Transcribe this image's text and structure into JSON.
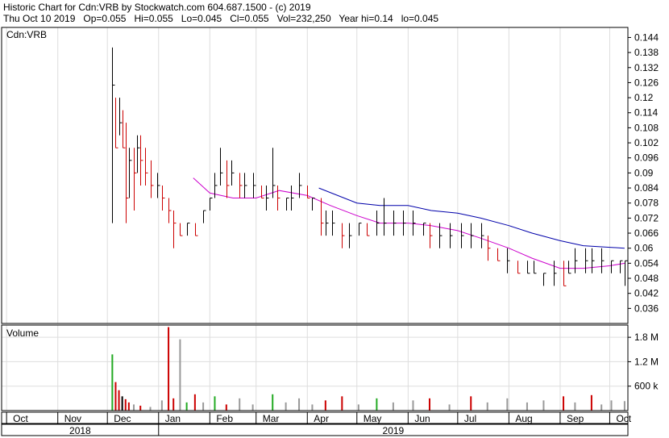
{
  "header": {
    "line1": "Historic Chart for Cdn:VRB by Stockwatch.com 604.687.1500 - (c) 2019",
    "line2": "Thu Oct 10 2019   Op=0.055   Hi=0.055   Lo=0.045   Cl=0.055   Vol=232,250   Year hi=0.14   lo=0.045"
  },
  "chart_data": {
    "type": "line",
    "price_panel": {
      "label": "Cdn:VRB",
      "ylim": [
        0.03,
        0.148
      ],
      "yticks": [
        "0.144",
        "0.138",
        "0.132",
        "0.126",
        "0.12",
        "0.114",
        "0.108",
        "0.102",
        "0.096",
        "0.09",
        "0.084",
        "0.078",
        "0.072",
        "0.066",
        "0.06",
        "0.054",
        "0.048",
        "0.042",
        "0.036"
      ],
      "ytick_values": [
        0.144,
        0.138,
        0.132,
        0.126,
        0.12,
        0.114,
        0.108,
        0.102,
        0.096,
        0.09,
        0.084,
        0.078,
        0.072,
        0.066,
        0.06,
        0.054,
        0.048,
        0.042,
        0.036
      ],
      "bar_colors": {
        "up": "#000000",
        "down": "#cc0000"
      },
      "bars": [
        {
          "d": "2018-12-04",
          "h": 0.14,
          "l": 0.07,
          "c": 0.125
        },
        {
          "d": "2018-12-06",
          "h": 0.12,
          "l": 0.1,
          "c": 0.1
        },
        {
          "d": "2018-12-08",
          "h": 0.12,
          "l": 0.105,
          "c": 0.11
        },
        {
          "d": "2018-12-10",
          "h": 0.115,
          "l": 0.1,
          "c": 0.1
        },
        {
          "d": "2018-12-12",
          "h": 0.11,
          "l": 0.07,
          "c": 0.08
        },
        {
          "d": "2018-12-14",
          "h": 0.1,
          "l": 0.08,
          "c": 0.095
        },
        {
          "d": "2018-12-17",
          "h": 0.1,
          "l": 0.075,
          "c": 0.09
        },
        {
          "d": "2018-12-19",
          "h": 0.105,
          "l": 0.09,
          "c": 0.1
        },
        {
          "d": "2018-12-21",
          "h": 0.105,
          "l": 0.085,
          "c": 0.095
        },
        {
          "d": "2018-12-24",
          "h": 0.1,
          "l": 0.085,
          "c": 0.09
        },
        {
          "d": "2018-12-27",
          "h": 0.095,
          "l": 0.08,
          "c": 0.085
        },
        {
          "d": "2018-12-31",
          "h": 0.09,
          "l": 0.08,
          "c": 0.085
        },
        {
          "d": "2019-01-03",
          "h": 0.085,
          "l": 0.075,
          "c": 0.08
        },
        {
          "d": "2019-01-07",
          "h": 0.08,
          "l": 0.07,
          "c": 0.075
        },
        {
          "d": "2019-01-10",
          "h": 0.075,
          "l": 0.06,
          "c": 0.07
        },
        {
          "d": "2019-01-14",
          "h": 0.07,
          "l": 0.065,
          "c": 0.065
        },
        {
          "d": "2019-01-18",
          "h": 0.07,
          "l": 0.065,
          "c": 0.07
        },
        {
          "d": "2019-01-23",
          "h": 0.07,
          "l": 0.065,
          "c": 0.065
        },
        {
          "d": "2019-01-28",
          "h": 0.075,
          "l": 0.07,
          "c": 0.075
        },
        {
          "d": "2019-02-01",
          "h": 0.08,
          "l": 0.075,
          "c": 0.08
        },
        {
          "d": "2019-02-04",
          "h": 0.09,
          "l": 0.08,
          "c": 0.085
        },
        {
          "d": "2019-02-07",
          "h": 0.1,
          "l": 0.085,
          "c": 0.09
        },
        {
          "d": "2019-02-11",
          "h": 0.095,
          "l": 0.08,
          "c": 0.085
        },
        {
          "d": "2019-02-14",
          "h": 0.095,
          "l": 0.085,
          "c": 0.09
        },
        {
          "d": "2019-02-19",
          "h": 0.09,
          "l": 0.08,
          "c": 0.085
        },
        {
          "d": "2019-02-22",
          "h": 0.09,
          "l": 0.08,
          "c": 0.085
        },
        {
          "d": "2019-02-27",
          "h": 0.09,
          "l": 0.08,
          "c": 0.085
        },
        {
          "d": "2019-03-04",
          "h": 0.085,
          "l": 0.08,
          "c": 0.08
        },
        {
          "d": "2019-03-07",
          "h": 0.085,
          "l": 0.075,
          "c": 0.08
        },
        {
          "d": "2019-03-11",
          "h": 0.1,
          "l": 0.08,
          "c": 0.085
        },
        {
          "d": "2019-03-14",
          "h": 0.085,
          "l": 0.075,
          "c": 0.08
        },
        {
          "d": "2019-03-19",
          "h": 0.08,
          "l": 0.075,
          "c": 0.08
        },
        {
          "d": "2019-03-22",
          "h": 0.085,
          "l": 0.075,
          "c": 0.08
        },
        {
          "d": "2019-03-27",
          "h": 0.09,
          "l": 0.08,
          "c": 0.085
        },
        {
          "d": "2019-04-01",
          "h": 0.085,
          "l": 0.08,
          "c": 0.08
        },
        {
          "d": "2019-04-04",
          "h": 0.08,
          "l": 0.075,
          "c": 0.08
        },
        {
          "d": "2019-04-09",
          "h": 0.08,
          "l": 0.065,
          "c": 0.07
        },
        {
          "d": "2019-04-12",
          "h": 0.075,
          "l": 0.065,
          "c": 0.07
        },
        {
          "d": "2019-04-16",
          "h": 0.075,
          "l": 0.065,
          "c": 0.07
        },
        {
          "d": "2019-04-22",
          "h": 0.07,
          "l": 0.06,
          "c": 0.065
        },
        {
          "d": "2019-04-26",
          "h": 0.07,
          "l": 0.06,
          "c": 0.065
        },
        {
          "d": "2019-05-02",
          "h": 0.07,
          "l": 0.065,
          "c": 0.07
        },
        {
          "d": "2019-05-07",
          "h": 0.07,
          "l": 0.065,
          "c": 0.065
        },
        {
          "d": "2019-05-13",
          "h": 0.075,
          "l": 0.065,
          "c": 0.07
        },
        {
          "d": "2019-05-17",
          "h": 0.08,
          "l": 0.065,
          "c": 0.07
        },
        {
          "d": "2019-05-23",
          "h": 0.075,
          "l": 0.065,
          "c": 0.07
        },
        {
          "d": "2019-05-29",
          "h": 0.075,
          "l": 0.065,
          "c": 0.07
        },
        {
          "d": "2019-06-04",
          "h": 0.075,
          "l": 0.065,
          "c": 0.07
        },
        {
          "d": "2019-06-10",
          "h": 0.07,
          "l": 0.065,
          "c": 0.07
        },
        {
          "d": "2019-06-14",
          "h": 0.07,
          "l": 0.06,
          "c": 0.065
        },
        {
          "d": "2019-06-20",
          "h": 0.07,
          "l": 0.06,
          "c": 0.065
        },
        {
          "d": "2019-06-26",
          "h": 0.07,
          "l": 0.06,
          "c": 0.065
        },
        {
          "d": "2019-07-03",
          "h": 0.07,
          "l": 0.06,
          "c": 0.065
        },
        {
          "d": "2019-07-09",
          "h": 0.07,
          "l": 0.06,
          "c": 0.065
        },
        {
          "d": "2019-07-15",
          "h": 0.07,
          "l": 0.06,
          "c": 0.065
        },
        {
          "d": "2019-07-19",
          "h": 0.065,
          "l": 0.055,
          "c": 0.06
        },
        {
          "d": "2019-07-25",
          "h": 0.06,
          "l": 0.055,
          "c": 0.055
        },
        {
          "d": "2019-07-31",
          "h": 0.06,
          "l": 0.05,
          "c": 0.055
        },
        {
          "d": "2019-08-06",
          "h": 0.055,
          "l": 0.05,
          "c": 0.05
        },
        {
          "d": "2019-08-12",
          "h": 0.055,
          "l": 0.05,
          "c": 0.05
        },
        {
          "d": "2019-08-16",
          "h": 0.055,
          "l": 0.05,
          "c": 0.05
        },
        {
          "d": "2019-08-22",
          "h": 0.05,
          "l": 0.045,
          "c": 0.05
        },
        {
          "d": "2019-08-28",
          "h": 0.055,
          "l": 0.045,
          "c": 0.05
        },
        {
          "d": "2019-09-03",
          "h": 0.055,
          "l": 0.045,
          "c": 0.045
        },
        {
          "d": "2019-09-06",
          "h": 0.055,
          "l": 0.05,
          "c": 0.05
        },
        {
          "d": "2019-09-10",
          "h": 0.06,
          "l": 0.05,
          "c": 0.055
        },
        {
          "d": "2019-09-16",
          "h": 0.06,
          "l": 0.05,
          "c": 0.055
        },
        {
          "d": "2019-09-20",
          "h": 0.06,
          "l": 0.05,
          "c": 0.055
        },
        {
          "d": "2019-09-26",
          "h": 0.06,
          "l": 0.05,
          "c": 0.055
        },
        {
          "d": "2019-10-02",
          "h": 0.055,
          "l": 0.05,
          "c": 0.055
        },
        {
          "d": "2019-10-07",
          "h": 0.055,
          "l": 0.05,
          "c": 0.055
        },
        {
          "d": "2019-10-10",
          "h": 0.055,
          "l": 0.045,
          "c": 0.055
        }
      ],
      "moving_averages": [
        {
          "color": "#cc00cc",
          "points": [
            [
              "2019-01-22",
              0.088
            ],
            [
              "2019-02-01",
              0.082
            ],
            [
              "2019-02-15",
              0.08
            ],
            [
              "2019-03-01",
              0.08
            ],
            [
              "2019-03-15",
              0.083
            ],
            [
              "2019-04-01",
              0.081
            ],
            [
              "2019-04-15",
              0.077
            ],
            [
              "2019-05-01",
              0.073
            ],
            [
              "2019-05-15",
              0.07
            ],
            [
              "2019-06-01",
              0.07
            ],
            [
              "2019-06-15",
              0.069
            ],
            [
              "2019-07-01",
              0.067
            ],
            [
              "2019-07-15",
              0.064
            ],
            [
              "2019-08-01",
              0.06
            ],
            [
              "2019-08-15",
              0.056
            ],
            [
              "2019-09-01",
              0.052
            ],
            [
              "2019-09-15",
              0.052
            ],
            [
              "2019-10-01",
              0.053
            ],
            [
              "2019-10-10",
              0.054
            ]
          ]
        },
        {
          "color": "#0000aa",
          "points": [
            [
              "2019-04-08",
              0.084
            ],
            [
              "2019-05-01",
              0.078
            ],
            [
              "2019-05-15",
              0.077
            ],
            [
              "2019-06-01",
              0.077
            ],
            [
              "2019-06-15",
              0.075
            ],
            [
              "2019-07-01",
              0.074
            ],
            [
              "2019-07-15",
              0.072
            ],
            [
              "2019-08-01",
              0.069
            ],
            [
              "2019-08-15",
              0.066
            ],
            [
              "2019-09-01",
              0.063
            ],
            [
              "2019-09-15",
              0.061
            ],
            [
              "2019-10-10",
              0.06
            ]
          ]
        }
      ]
    },
    "volume_panel": {
      "label": "Volume",
      "ylim": [
        0,
        2100000
      ],
      "yticks": [
        "1.8 M",
        "1.2 M",
        "600 k"
      ],
      "ytick_values": [
        1800000,
        1200000,
        600000
      ],
      "bars": [
        {
          "d": "2018-12-04",
          "v": 1380000,
          "c": "#22aa22"
        },
        {
          "d": "2018-12-06",
          "v": 700000,
          "c": "#cc0000"
        },
        {
          "d": "2018-12-08",
          "v": 500000,
          "c": "#cc0000"
        },
        {
          "d": "2018-12-10",
          "v": 350000,
          "c": "#000000"
        },
        {
          "d": "2018-12-12",
          "v": 280000,
          "c": "#cc0000"
        },
        {
          "d": "2018-12-14",
          "v": 200000,
          "c": "#cc0000"
        },
        {
          "d": "2018-12-17",
          "v": 150000,
          "c": "#999999"
        },
        {
          "d": "2018-12-21",
          "v": 120000,
          "c": "#cc0000"
        },
        {
          "d": "2018-12-27",
          "v": 90000,
          "c": "#999999"
        },
        {
          "d": "2019-01-03",
          "v": 250000,
          "c": "#999999"
        },
        {
          "d": "2019-01-07",
          "v": 2050000,
          "c": "#cc0000"
        },
        {
          "d": "2019-01-10",
          "v": 300000,
          "c": "#cc0000"
        },
        {
          "d": "2019-01-14",
          "v": 1750000,
          "c": "#999999"
        },
        {
          "d": "2019-01-18",
          "v": 200000,
          "c": "#22aa22"
        },
        {
          "d": "2019-01-23",
          "v": 400000,
          "c": "#cc0000"
        },
        {
          "d": "2019-01-28",
          "v": 200000,
          "c": "#999999"
        },
        {
          "d": "2019-02-04",
          "v": 350000,
          "c": "#22aa22"
        },
        {
          "d": "2019-02-11",
          "v": 150000,
          "c": "#cc0000"
        },
        {
          "d": "2019-02-19",
          "v": 300000,
          "c": "#999999"
        },
        {
          "d": "2019-02-27",
          "v": 150000,
          "c": "#999999"
        },
        {
          "d": "2019-03-11",
          "v": 400000,
          "c": "#22aa22"
        },
        {
          "d": "2019-03-19",
          "v": 200000,
          "c": "#999999"
        },
        {
          "d": "2019-03-27",
          "v": 300000,
          "c": "#999999"
        },
        {
          "d": "2019-04-04",
          "v": 150000,
          "c": "#999999"
        },
        {
          "d": "2019-04-12",
          "v": 250000,
          "c": "#cc0000"
        },
        {
          "d": "2019-04-22",
          "v": 350000,
          "c": "#cc0000"
        },
        {
          "d": "2019-05-02",
          "v": 150000,
          "c": "#999999"
        },
        {
          "d": "2019-05-13",
          "v": 300000,
          "c": "#22aa22"
        },
        {
          "d": "2019-05-23",
          "v": 200000,
          "c": "#999999"
        },
        {
          "d": "2019-06-04",
          "v": 250000,
          "c": "#999999"
        },
        {
          "d": "2019-06-14",
          "v": 300000,
          "c": "#cc0000"
        },
        {
          "d": "2019-06-26",
          "v": 150000,
          "c": "#999999"
        },
        {
          "d": "2019-07-09",
          "v": 350000,
          "c": "#cc0000"
        },
        {
          "d": "2019-07-19",
          "v": 200000,
          "c": "#999999"
        },
        {
          "d": "2019-07-31",
          "v": 300000,
          "c": "#999999"
        },
        {
          "d": "2019-08-12",
          "v": 200000,
          "c": "#999999"
        },
        {
          "d": "2019-08-22",
          "v": 250000,
          "c": "#999999"
        },
        {
          "d": "2019-09-03",
          "v": 350000,
          "c": "#cc0000"
        },
        {
          "d": "2019-09-10",
          "v": 200000,
          "c": "#999999"
        },
        {
          "d": "2019-09-20",
          "v": 380000,
          "c": "#cc0000"
        },
        {
          "d": "2019-09-26",
          "v": 150000,
          "c": "#999999"
        },
        {
          "d": "2019-10-02",
          "v": 250000,
          "c": "#999999"
        },
        {
          "d": "2019-10-10",
          "v": 232250,
          "c": "#999999"
        }
      ]
    },
    "xaxis": {
      "range": [
        "2018-09-28",
        "2019-10-12"
      ],
      "months": [
        {
          "label": "Oct",
          "d": "2018-10-01"
        },
        {
          "label": "Nov",
          "d": "2018-11-01"
        },
        {
          "label": "Dec",
          "d": "2018-12-01"
        },
        {
          "label": "Jan",
          "d": "2019-01-01"
        },
        {
          "label": "Feb",
          "d": "2019-02-01"
        },
        {
          "label": "Mar",
          "d": "2019-03-01"
        },
        {
          "label": "Apr",
          "d": "2019-04-01"
        },
        {
          "label": "May",
          "d": "2019-05-01"
        },
        {
          "label": "Jun",
          "d": "2019-06-01"
        },
        {
          "label": "Jul",
          "d": "2019-07-01"
        },
        {
          "label": "Aug",
          "d": "2019-08-01"
        },
        {
          "label": "Sep",
          "d": "2019-09-01"
        },
        {
          "label": "Oct",
          "d": "2019-10-01"
        }
      ],
      "years": [
        {
          "label": "2018",
          "from": "2018-09-28",
          "to": "2019-01-01"
        },
        {
          "label": "2019",
          "from": "2019-01-01",
          "to": "2019-10-12"
        }
      ]
    },
    "grid": true
  }
}
